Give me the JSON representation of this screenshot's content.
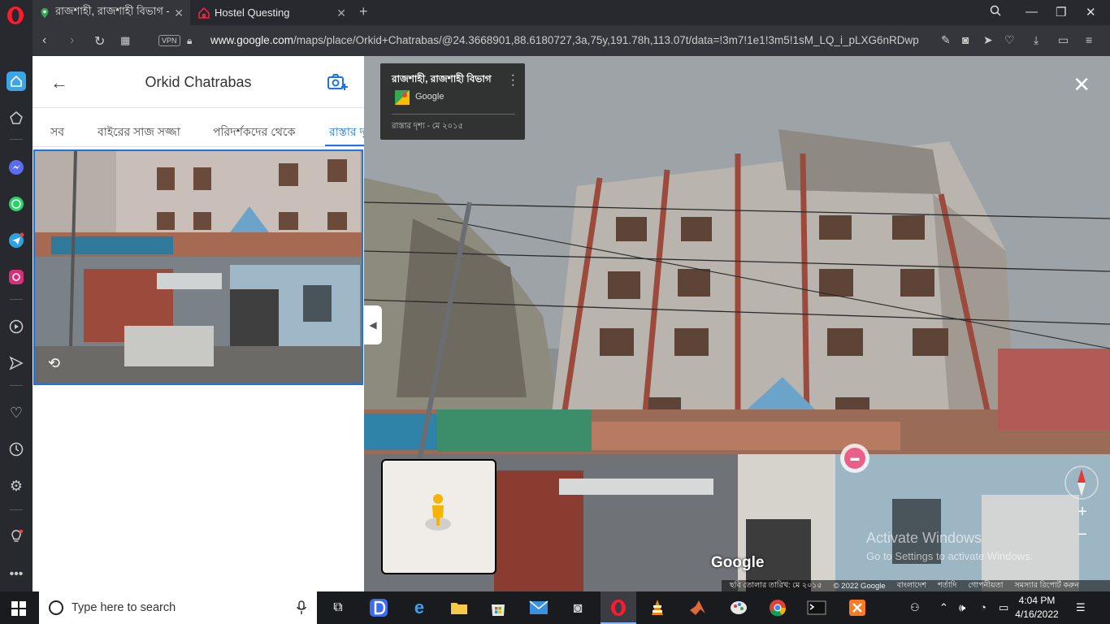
{
  "browser": {
    "tabs": [
      {
        "title": "রাজশাহী, রাজশাহী বিভাগ - "
      },
      {
        "title": "Hostel Questing"
      }
    ],
    "url_prefix": "www.google.com",
    "url_rest": "/maps/place/Orkid+Chatrabas/@24.3668901,88.6180727,3a,75y,191.78h,113.07t/data=!3m7!1e1!3m5!1sM_LQ_i_pLXG6nRDwp",
    "vpn_label": "VPN"
  },
  "panel": {
    "title": "Orkid Chatrabas",
    "tabs": [
      "সব",
      "বাইরের সাজ সজ্জা",
      "পরিদর্শকদের থেকে",
      "রাস্তার দৃ"
    ]
  },
  "streetview": {
    "location": "রাজশাহী, রাজশাহী বিভাগ",
    "source": "Google",
    "capture_date": "রাস্তার দৃশ্য - মে ২০১৫",
    "watermark": "Google",
    "activate_title": "Activate Windows",
    "activate_sub": "Go to Settings to activate Windows.",
    "footer": [
      "ছবি তোলার তারিখ: মে ২০১৫",
      "© 2022 Google",
      "বাংলাদেশ",
      "শর্তাদি",
      "গোপনীয়তা",
      "সমস্যার রিপোর্ট করুন"
    ]
  },
  "taskbar": {
    "search_placeholder": "Type here to search",
    "time": "4:04 PM",
    "date": "4/16/2022"
  },
  "colors": {
    "accent": "#1a73e8",
    "opera_red": "#ff1b2d",
    "hotel_pin": "#e8608a"
  }
}
